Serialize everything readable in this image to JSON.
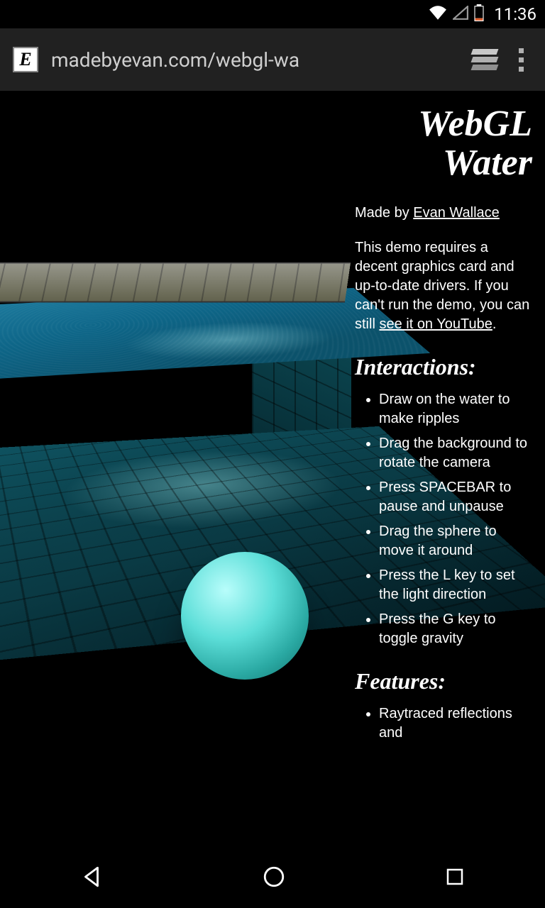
{
  "status": {
    "time": "11:36"
  },
  "browser": {
    "favicon_letter": "E",
    "url": "madebyevan.com/webgl-wa"
  },
  "page": {
    "title": "WebGL Water",
    "byline_prefix": "Made by ",
    "byline_link": "Evan Wallace",
    "desc_part1": "This demo requires a decent graphics card and up-to-date drivers. If you can't run the demo, you can still ",
    "desc_link": "see it on YouTube",
    "desc_part2": ".",
    "interactions_heading": "Interactions:",
    "interactions": [
      "Draw on the water to make ripples",
      "Drag the background to rotate the camera",
      "Press SPACEBAR to pause and unpause",
      "Drag the sphere to move it around",
      "Press the L key to set the light direction",
      "Press the G key to toggle gravity"
    ],
    "features_heading": "Features:",
    "features": [
      "Raytraced reflections and"
    ]
  }
}
